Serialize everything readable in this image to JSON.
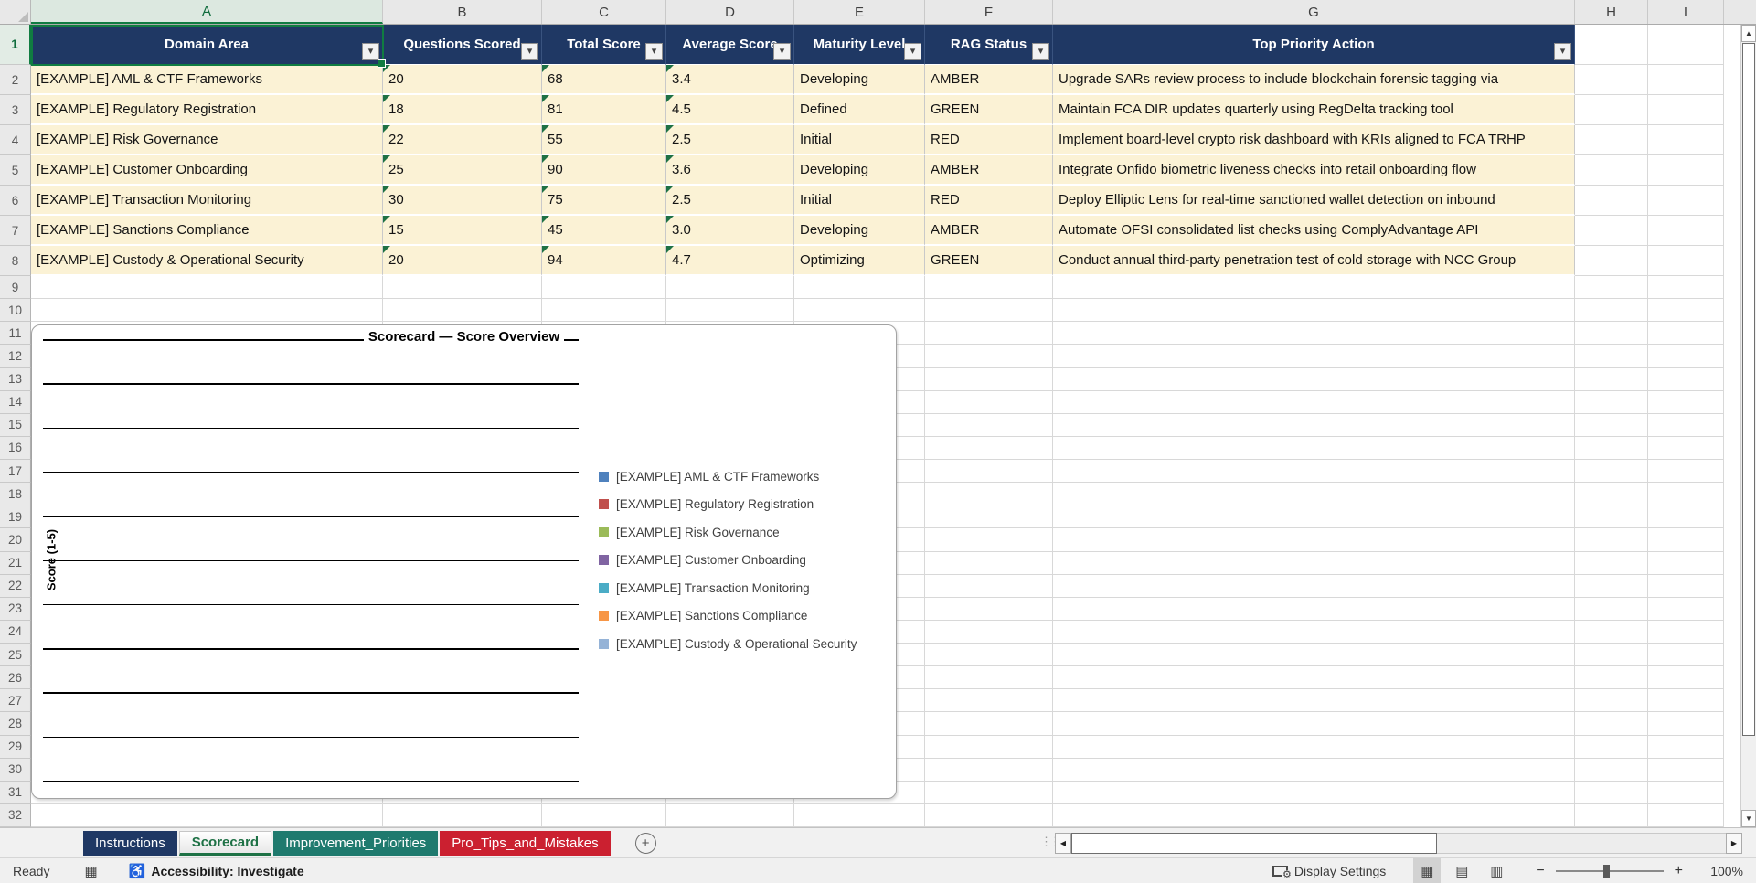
{
  "columns": [
    "A",
    "B",
    "C",
    "D",
    "E",
    "F",
    "G",
    "H",
    "I"
  ],
  "row_count": 32,
  "selection": {
    "active_cell": "A1",
    "active_column": "A",
    "active_row": 1
  },
  "table": {
    "headers": [
      "Domain Area",
      "Questions Scored",
      "Total Score",
      "Average Score",
      "Maturity Level",
      "RAG Status",
      "Top Priority Action"
    ],
    "rows": [
      [
        "[EXAMPLE] AML & CTF Frameworks",
        "20",
        "68",
        "3.4",
        "Developing",
        "AMBER",
        "Upgrade SARs review process to include blockchain forensic tagging via"
      ],
      [
        "[EXAMPLE] Regulatory Registration",
        "18",
        "81",
        "4.5",
        "Defined",
        "GREEN",
        "Maintain FCA DIR updates quarterly using RegDelta tracking tool"
      ],
      [
        "[EXAMPLE] Risk Governance",
        "22",
        "55",
        "2.5",
        "Initial",
        "RED",
        "Implement board-level crypto risk dashboard with KRIs aligned to FCA TRHP"
      ],
      [
        "[EXAMPLE] Customer Onboarding",
        "25",
        "90",
        "3.6",
        "Developing",
        "AMBER",
        "Integrate Onfido biometric liveness checks into retail onboarding flow"
      ],
      [
        "[EXAMPLE] Transaction Monitoring",
        "30",
        "75",
        "2.5",
        "Initial",
        "RED",
        "Deploy Elliptic Lens for real-time sanctioned wallet detection on inbound"
      ],
      [
        "[EXAMPLE] Sanctions Compliance",
        "15",
        "45",
        "3.0",
        "Developing",
        "AMBER",
        "Automate OFSI consolidated list checks using ComplyAdvantage API"
      ],
      [
        "[EXAMPLE] Custody & Operational Security",
        "20",
        "94",
        "4.7",
        "Optimizing",
        "GREEN",
        "Conduct annual third-party penetration test of cold storage with NCC Group"
      ]
    ],
    "error_indicator_columns": [
      1,
      2,
      3
    ]
  },
  "chart_data": {
    "type": "bar",
    "title": "Scorecard — Score Overview",
    "ylabel": "Score (1-5)",
    "ylim": [
      0,
      5
    ],
    "gridline_count": 11,
    "grid": true,
    "legend_position": "right",
    "plot_rendered_empty": true,
    "series": [
      {
        "name": "[EXAMPLE] AML & CTF Frameworks",
        "color": "#4F81BD",
        "values": []
      },
      {
        "name": "[EXAMPLE] Regulatory Registration",
        "color": "#C0504D",
        "values": []
      },
      {
        "name": "[EXAMPLE] Risk Governance",
        "color": "#9BBB59",
        "values": []
      },
      {
        "name": "[EXAMPLE] Customer Onboarding",
        "color": "#8064A2",
        "values": []
      },
      {
        "name": "[EXAMPLE] Transaction Monitoring",
        "color": "#4BACC6",
        "values": []
      },
      {
        "name": "[EXAMPLE] Sanctions Compliance",
        "color": "#F79646",
        "values": []
      },
      {
        "name": "[EXAMPLE] Custody & Operational Security",
        "color": "#95B3D7",
        "values": []
      }
    ]
  },
  "sheet_tabs": [
    {
      "label": "Instructions",
      "bg": "#1F3864",
      "fg": "#FFFFFF",
      "active": false
    },
    {
      "label": "Scorecard",
      "bg": "#FFFFFF",
      "fg": "#1E7145",
      "active": true
    },
    {
      "label": "Improvement_Priorities",
      "bg": "#1F7A6E",
      "fg": "#FFFFFF",
      "active": false
    },
    {
      "label": "Pro_Tips_and_Mistakes",
      "bg": "#CB2030",
      "fg": "#FFFFFF",
      "active": false
    }
  ],
  "tab_bar": {
    "new_sheet_label": "+"
  },
  "status_bar": {
    "mode": "Ready",
    "accessibility": "Accessibility: Investigate",
    "display_settings": "Display Settings",
    "zoom_level": "100%",
    "zoom_minus": "−",
    "zoom_plus": "+"
  },
  "icons": {
    "filter_arrow": "▾",
    "scroll_up": "▲",
    "scroll_down": "▼",
    "scroll_left": "◀",
    "scroll_right": "▶",
    "view_normal": "▦",
    "view_page_layout": "▤",
    "view_page_break": "▥",
    "accessibility": "♿",
    "macro_record": "▦",
    "gear": "⚙",
    "grip": "⋮⋮"
  },
  "colors": {
    "table_header_bg": "#1F3864",
    "data_row_bg": "#FBF2D5",
    "selection_green": "#107C41",
    "active_tab_green": "#1E7145",
    "rag_values_plain_text": true
  }
}
